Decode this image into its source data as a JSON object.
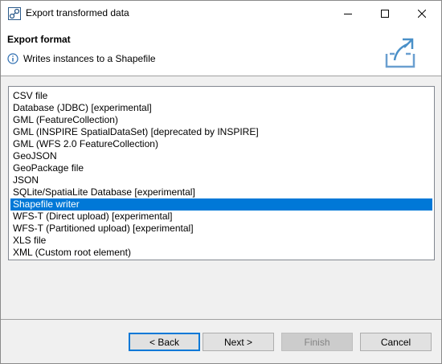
{
  "window": {
    "title": "Export transformed data"
  },
  "header": {
    "title": "Export format",
    "message": "Writes instances to a Shapefile",
    "info_icon": "info-icon",
    "banner_icon": "export-icon"
  },
  "formats": [
    {
      "label": "CSV file",
      "selected": false
    },
    {
      "label": "Database (JDBC) [experimental]",
      "selected": false
    },
    {
      "label": "GML (FeatureCollection)",
      "selected": false
    },
    {
      "label": "GML (INSPIRE SpatialDataSet) [deprecated by INSPIRE]",
      "selected": false
    },
    {
      "label": "GML (WFS 2.0 FeatureCollection)",
      "selected": false
    },
    {
      "label": "GeoJSON",
      "selected": false
    },
    {
      "label": "GeoPackage file",
      "selected": false
    },
    {
      "label": "JSON",
      "selected": false
    },
    {
      "label": "SQLite/SpatiaLite Database [experimental]",
      "selected": false
    },
    {
      "label": "Shapefile writer",
      "selected": true
    },
    {
      "label": "WFS-T (Direct upload) [experimental]",
      "selected": false
    },
    {
      "label": "WFS-T (Partitioned upload) [experimental]",
      "selected": false
    },
    {
      "label": "XLS file",
      "selected": false
    },
    {
      "label": "XML (Custom root element)",
      "selected": false
    }
  ],
  "buttons": {
    "back": "< Back",
    "next": "Next >",
    "finish": "Finish",
    "cancel": "Cancel"
  },
  "colors": {
    "selection": "#0078d7",
    "accent_icon": "#4a90c8"
  }
}
